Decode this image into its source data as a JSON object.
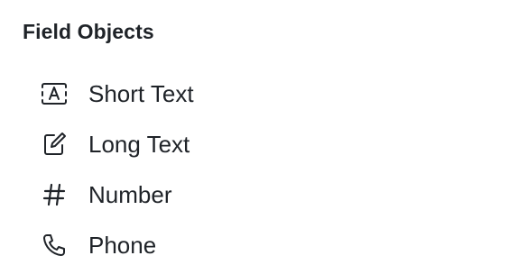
{
  "section": {
    "title": "Field Objects"
  },
  "items": [
    {
      "label": "Short Text",
      "icon": "short-text-icon"
    },
    {
      "label": "Long Text",
      "icon": "long-text-icon"
    },
    {
      "label": "Number",
      "icon": "number-icon"
    },
    {
      "label": "Phone",
      "icon": "phone-icon"
    }
  ],
  "colors": {
    "text": "#1f2328",
    "icon": "#1f2328",
    "background": "#ffffff"
  }
}
